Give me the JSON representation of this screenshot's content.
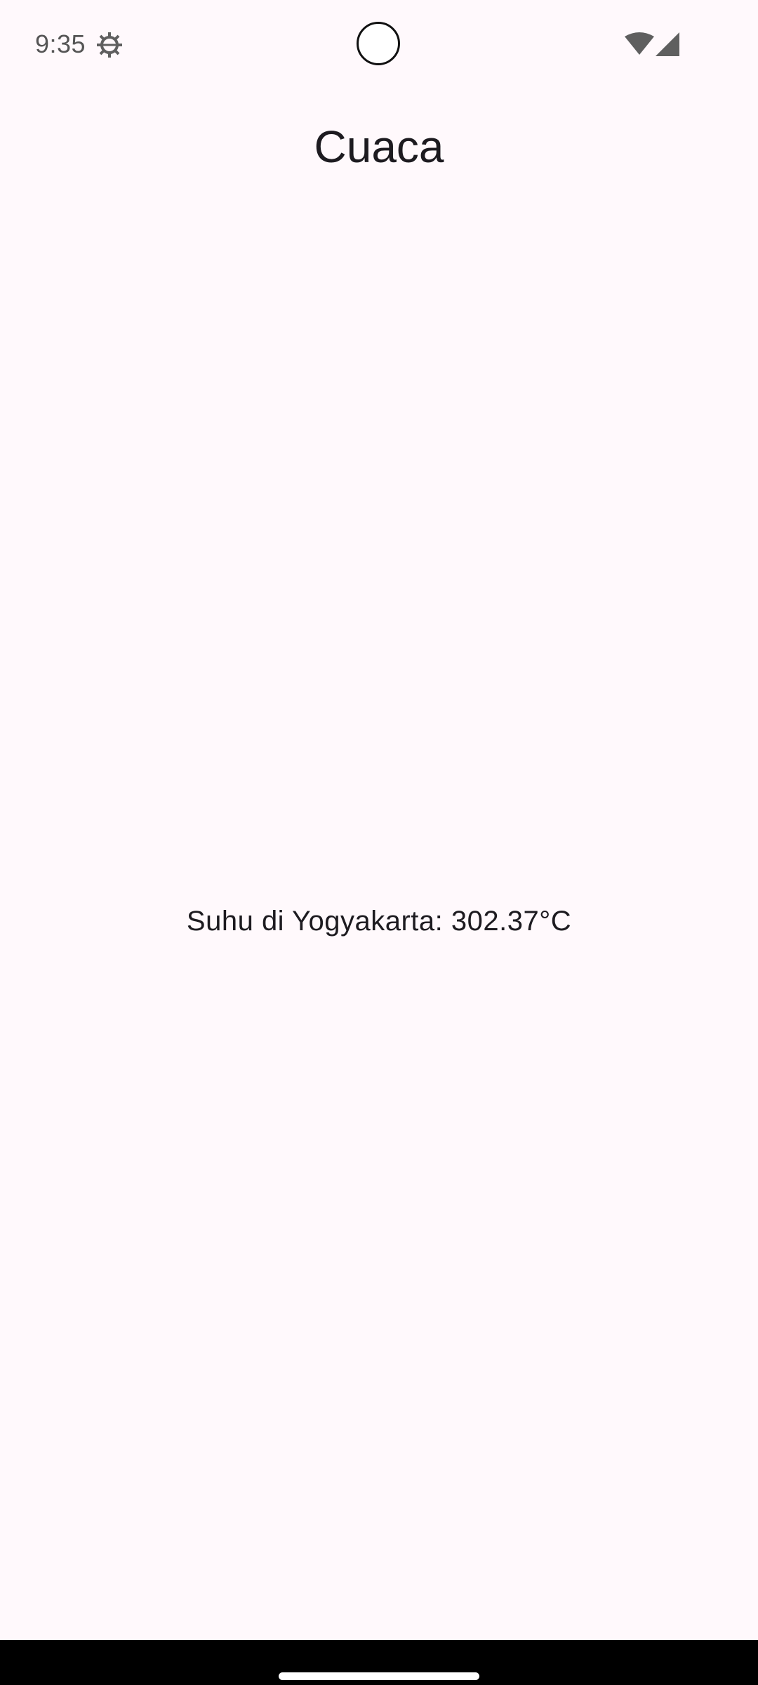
{
  "status_bar": {
    "time": "9:35",
    "icons": [
      "settings-icon",
      "wifi-icon",
      "cell-signal-icon"
    ]
  },
  "app": {
    "title": "Cuaca",
    "temperature_text": "Suhu di Yogyakarta: 302.37°C"
  },
  "colors": {
    "background": "#FFF9FC",
    "text": "#1D1B20",
    "status_icon": "#5F5F5F"
  }
}
